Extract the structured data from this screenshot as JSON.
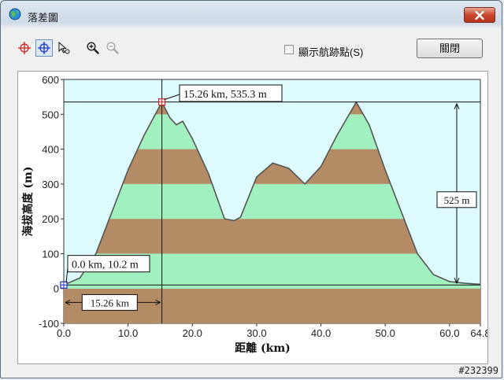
{
  "window": {
    "title": "落差圖",
    "close_icon": "close-icon"
  },
  "toolbar": {
    "tools": [
      {
        "name": "crosshair-red-icon",
        "color": "#d42020"
      },
      {
        "name": "crosshair-blue-icon",
        "color": "#2030c8"
      },
      {
        "name": "select-cursor-icon"
      },
      {
        "name": "zoom-in-icon"
      },
      {
        "name": "zoom-out-icon"
      }
    ],
    "show_waypoints_label": "顯示航跡點(S)",
    "show_waypoints_checked": false,
    "close_label": "關閉"
  },
  "chart_data": {
    "type": "area",
    "xlabel": "距離 (km)",
    "ylabel": "海拔高度 (m)",
    "xlim": [
      0,
      64.8
    ],
    "ylim": [
      -100,
      600
    ],
    "x_ticks": [
      "0.0",
      "10.0",
      "20.0",
      "30.0",
      "40.0",
      "50.0",
      "60.0",
      "64.8"
    ],
    "y_ticks": [
      "-100",
      "0",
      "100",
      "200",
      "300",
      "400",
      "500",
      "600"
    ],
    "band_colors": [
      "#b38b64",
      "#a0f0c0"
    ],
    "band_step": 100,
    "background": "#ddfbfd",
    "line_color": "#555555",
    "profile": {
      "x": [
        0,
        2.5,
        5,
        7.5,
        10,
        12.5,
        15.26,
        16.5,
        17.5,
        18.5,
        20,
        22.5,
        25,
        26.5,
        27.5,
        30,
        32.5,
        35,
        37.5,
        40,
        42.5,
        45.5,
        47.5,
        50,
        52.5,
        55,
        57.5,
        60,
        62.5,
        64.8
      ],
      "y": [
        10.2,
        30,
        100,
        220,
        340,
        440,
        535.3,
        490,
        470,
        480,
        430,
        330,
        200,
        195,
        205,
        320,
        360,
        345,
        300,
        350,
        440,
        535,
        470,
        340,
        220,
        100,
        40,
        20,
        15,
        12
      ]
    },
    "markers": [
      {
        "x": 0.0,
        "y": 10.2,
        "label": "0.0 km, 10.2 m",
        "color": "#2030c8"
      },
      {
        "x": 15.26,
        "y": 535.3,
        "label": "15.26 km, 535.3 m",
        "color": "#d42020"
      }
    ],
    "distance_label": "15.26 km",
    "height_diff_label": "525 m"
  },
  "watermark": "#232399"
}
